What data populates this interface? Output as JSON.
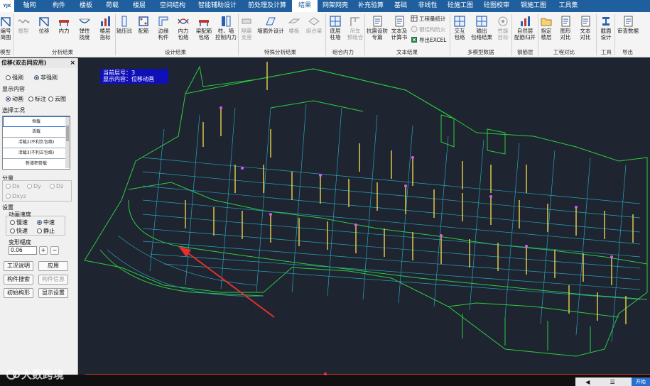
{
  "menu": {
    "logo": "YJK",
    "items": [
      "轴网",
      "构件",
      "楼板",
      "荷载",
      "楼层",
      "空间结构",
      "智能辅助设计",
      "前处理及计算",
      "结果",
      "网架网壳",
      "补充验算",
      "基础",
      "非线性",
      "砼施工图",
      "砼图校审",
      "钢施工图",
      "工具集"
    ],
    "active": "结果"
  },
  "ribbon": {
    "buttons": {
      "b0": "编号\n简图",
      "b1": "振型",
      "b2": "位移",
      "b3": "内力",
      "b4": "弹性\n挠度",
      "b5": "楼层\n指标",
      "b6": "轴压比",
      "b7": "配筋",
      "b8": "边缘\n构件",
      "b9": "内力\n包络",
      "b10": "梁配筋\n包络",
      "b11": "柱、墙\n控制内力",
      "b12": "隔震\n支座",
      "b13": "墙面外设计",
      "b14": "楼板",
      "b15": "组合梁",
      "b16": "底层\n柱墙",
      "b17": "吊车\n预组合",
      "b18": "抗震设防\n专篇",
      "b19": "文本及\n计算书",
      "b20": "交互\n包络",
      "b21": "输出\n包络结果",
      "b22": "性能\n目标",
      "b23": "自然层\n配筋归并",
      "b24": "指定\n楼层",
      "b25": "图形\n对比",
      "b26": "文本\n对比",
      "b27": "截面\n设计",
      "b28": "审查数据"
    },
    "small": {
      "s1": "工程量统计",
      "s2": "钢结构防火",
      "s3": "导出EXCEL"
    },
    "groups": {
      "g0": "模型",
      "g1": "分析结果",
      "g2": "设计结果",
      "g3": "特殊分析结果",
      "g4": "组合内力",
      "g5": "文本结果",
      "g6": "多模型数据",
      "g7": "钢筋层",
      "g8": "工程对比",
      "g9": "工具",
      "g10": "导出"
    }
  },
  "panel": {
    "title": "位移(双击同应用)",
    "close": "×",
    "rigid_label": "强刚",
    "nonrigid_label": "非强刚",
    "display_title": "显示内容",
    "display_anim": "动画",
    "display_note": "标注",
    "display_cloud": "云图",
    "case_title": "选择工况",
    "cases": [
      "恒载",
      "活载",
      "活载2(不利负包络)",
      "活载3(不利正包络)",
      "新增积荷载"
    ],
    "component_title": "分量",
    "dx": "Dx",
    "dy": "Dy",
    "dz": "Dz",
    "dxyz": "Dxyz",
    "settings_title": "设置",
    "speed_title": "动画速度",
    "slow": "慢速",
    "medium": "中速",
    "fast": "快速",
    "still": "静止",
    "amplitude_title": "变形幅度",
    "amplitude_value": "0.06",
    "plus": "+",
    "minus": "−",
    "btn_case_desc": "工况说明",
    "btn_apply": "应用",
    "btn_search": "构件搜索",
    "btn_info": "构件信息",
    "btn_init": "初始构形",
    "btn_display": "显示设置"
  },
  "canvas": {
    "floor_label": "当前层号：3",
    "content_label": "显示内容：位移动画"
  },
  "footer": {
    "watermark": "大数跨境",
    "start": "开始"
  }
}
